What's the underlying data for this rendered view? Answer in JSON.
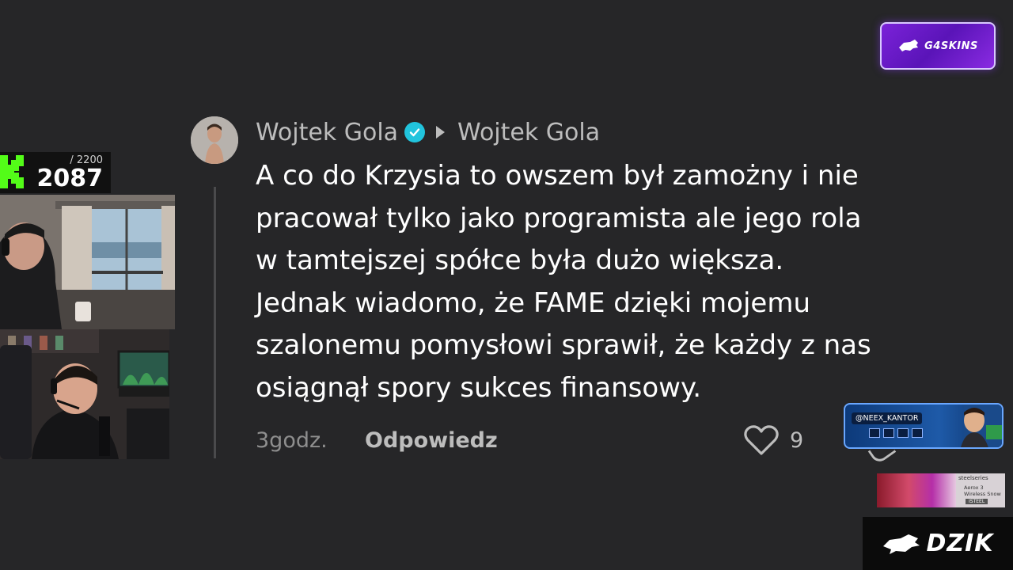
{
  "sponsor_top": {
    "label": "G4SKINS"
  },
  "counter": {
    "max": "/ 2200",
    "value": "2087"
  },
  "comment": {
    "author": "Wojtek Gola",
    "reply_to": "Wojtek Gola",
    "text": "A co do Krzysia to owszem był zamożny i nie\npracował tylko jako programista ale jego rola\nw tamtejszej spółce była dużo większa.\nJednak wiadomo, że FAME dzięki mojemu\nszalonemu pomysłowi sprawił, że każdy z nas\nosiągnął spory sukces finansowy.",
    "time": "3godz.",
    "reply_label": "Odpowiedz",
    "likes": "9"
  },
  "streamer_card": {
    "handle": "@NEEX_KANTOR"
  },
  "ad_banner": {
    "brand": "steelseries",
    "product": "Aerox 3 Wireless Snow",
    "tag": "ISTEEL"
  },
  "sponsor_bottom": {
    "label": "DZIK"
  },
  "colors": {
    "background": "#262628",
    "verified": "#21c4dd",
    "sponsor_purple": "#7b22d9"
  }
}
